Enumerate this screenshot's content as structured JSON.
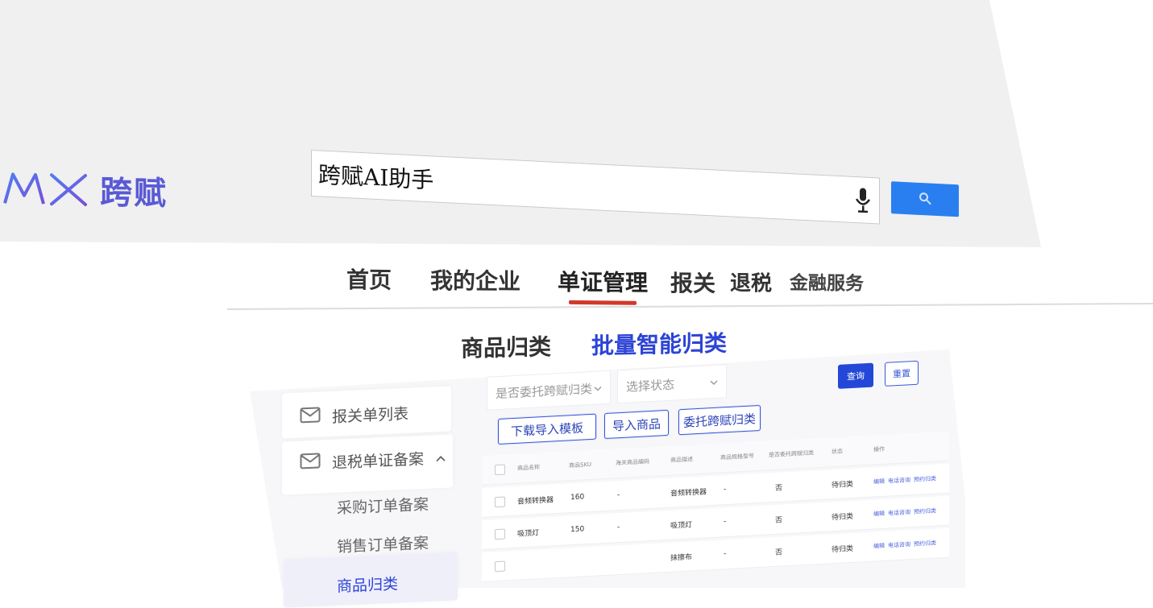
{
  "brand": {
    "mark": "MX",
    "name": "跨赋",
    "color": "#5a5ad6"
  },
  "search": {
    "value": "跨赋AI助手",
    "button_color": "#2a7ff0"
  },
  "nav": {
    "items": [
      "首页",
      "我的企业",
      "单证管理",
      "报关",
      "退税",
      "金融服务"
    ],
    "active_index": 2,
    "active_underline_color": "#d0392b"
  },
  "tabs": {
    "items": [
      "商品归类",
      "批量智能归类"
    ],
    "active_index": 1,
    "active_color": "#2d44d6"
  },
  "sidebar": {
    "items": [
      {
        "label": "报关单列表",
        "icon": "mail-icon"
      },
      {
        "label": "退税单证备案",
        "icon": "mail-icon",
        "expanded": true
      }
    ],
    "sub_items": [
      "采购订单备案",
      "销售订单备案",
      "商品归类"
    ]
  },
  "filters": {
    "entrust_placeholder": "是否委托跨赋归类",
    "status_placeholder": "选择状态",
    "query_label": "查询",
    "reset_label": "重置"
  },
  "actions": {
    "download_template": "下载导入模板",
    "import_goods": "导入商品",
    "entrust_classify": "委托跨赋归类"
  },
  "table": {
    "headers": [
      "商品名称",
      "商品SKU",
      "海关商品编码",
      "商品描述",
      "商品规格型号",
      "是否委托跨赋归类",
      "状态",
      "操作"
    ],
    "rows": [
      {
        "name": "音频转换器",
        "sku": "160",
        "hs_code": "-",
        "desc": "音频转换器",
        "spec": "-",
        "entrust": "否",
        "status": "待归类"
      },
      {
        "name": "吸顶灯",
        "sku": "150",
        "hs_code": "-",
        "desc": "吸顶灯",
        "spec": "-",
        "entrust": "否",
        "status": "待归类"
      },
      {
        "name": "",
        "sku": "",
        "hs_code": "",
        "desc": "抹擦布",
        "spec": "-",
        "entrust": "否",
        "status": "待归类"
      }
    ],
    "row_actions": [
      "编辑",
      "电话咨询",
      "预约归类"
    ]
  }
}
